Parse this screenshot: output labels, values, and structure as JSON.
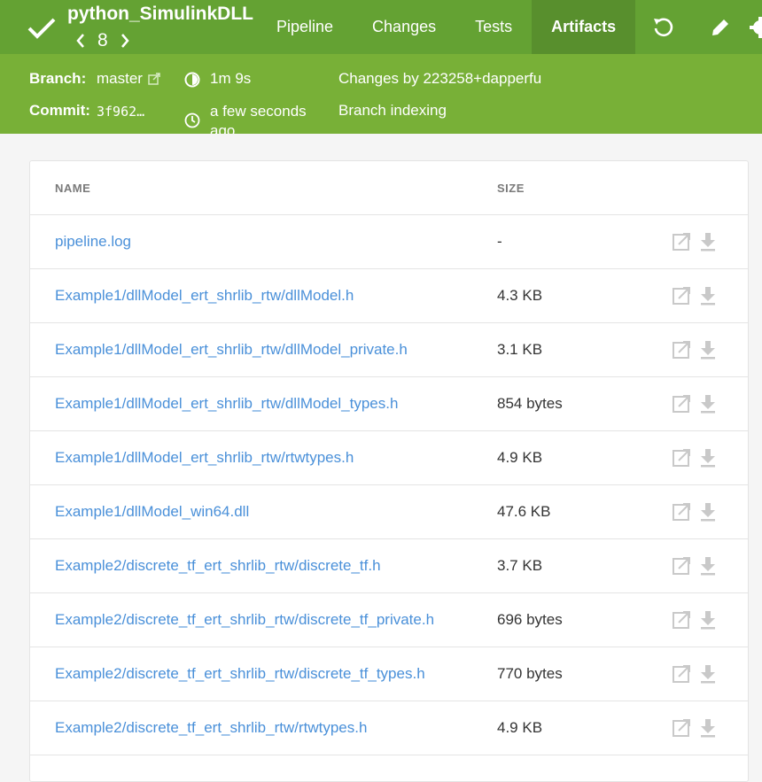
{
  "header": {
    "title": "python_SimulinkDLL",
    "run_number": "8",
    "tabs": [
      {
        "label": "Pipeline",
        "active": false
      },
      {
        "label": "Changes",
        "active": false
      },
      {
        "label": "Tests",
        "active": false
      },
      {
        "label": "Artifacts",
        "active": true
      }
    ],
    "status_icon": "checkmark-icon",
    "actions": [
      "replay-icon",
      "edit-pencil-icon",
      "settings-gear-icon"
    ],
    "colors": {
      "bar": "#64a233",
      "meta": "#78b037",
      "active_tab": "#588f2d"
    }
  },
  "meta": {
    "branch_label": "Branch:",
    "branch_value": "master",
    "commit_label": "Commit:",
    "commit_value": "3f962…",
    "duration": "1m 9s",
    "time": "a few seconds ago",
    "changes": "Changes by 223258+dapperfu",
    "cause": "Branch indexing"
  },
  "artifacts": {
    "columns": {
      "name": "NAME",
      "size": "SIZE"
    },
    "rows": [
      {
        "name": "pipeline.log",
        "size": "-"
      },
      {
        "name": "Example1/dllModel_ert_shrlib_rtw/dllModel.h",
        "size": "4.3 KB"
      },
      {
        "name": "Example1/dllModel_ert_shrlib_rtw/dllModel_private.h",
        "size": "3.1 KB"
      },
      {
        "name": "Example1/dllModel_ert_shrlib_rtw/dllModel_types.h",
        "size": "854 bytes"
      },
      {
        "name": "Example1/dllModel_ert_shrlib_rtw/rtwtypes.h",
        "size": "4.9 KB"
      },
      {
        "name": "Example1/dllModel_win64.dll",
        "size": "47.6 KB"
      },
      {
        "name": "Example2/discrete_tf_ert_shrlib_rtw/discrete_tf.h",
        "size": "3.7 KB"
      },
      {
        "name": "Example2/discrete_tf_ert_shrlib_rtw/discrete_tf_private.h",
        "size": "696 bytes"
      },
      {
        "name": "Example2/discrete_tf_ert_shrlib_rtw/discrete_tf_types.h",
        "size": "770 bytes"
      },
      {
        "name": "Example2/discrete_tf_ert_shrlib_rtw/rtwtypes.h",
        "size": "4.9 KB"
      }
    ]
  }
}
